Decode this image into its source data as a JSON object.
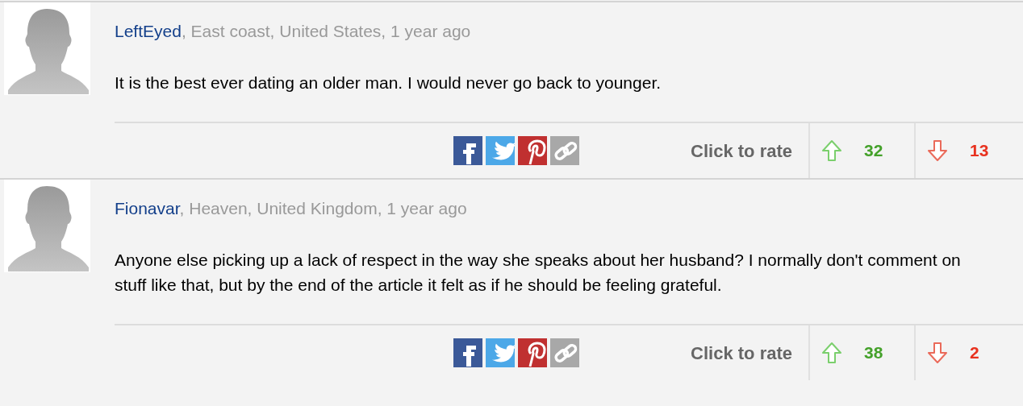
{
  "comments": [
    {
      "author": "LeftEyed",
      "meta": ", East coast, United States, 1 year ago",
      "body": "It is the best ever dating an older man. I would never go back to younger.",
      "rate_label": "Click to rate",
      "ratings": [
        {
          "kind": "up",
          "count": "32"
        },
        {
          "kind": "down",
          "count": "13"
        }
      ]
    },
    {
      "author": "Fionavar",
      "meta": ", Heaven, United Kingdom, 1 year ago",
      "body": "Anyone else picking up a lack of respect in the way she speaks about her husband? I normally don't comment on stuff like that, but by the end of the article it felt as if he should be feeling grateful.",
      "rate_label": "Click to rate",
      "ratings": [
        {
          "kind": "up",
          "count": "38"
        },
        {
          "kind": "down",
          "count": "2"
        }
      ]
    }
  ]
}
